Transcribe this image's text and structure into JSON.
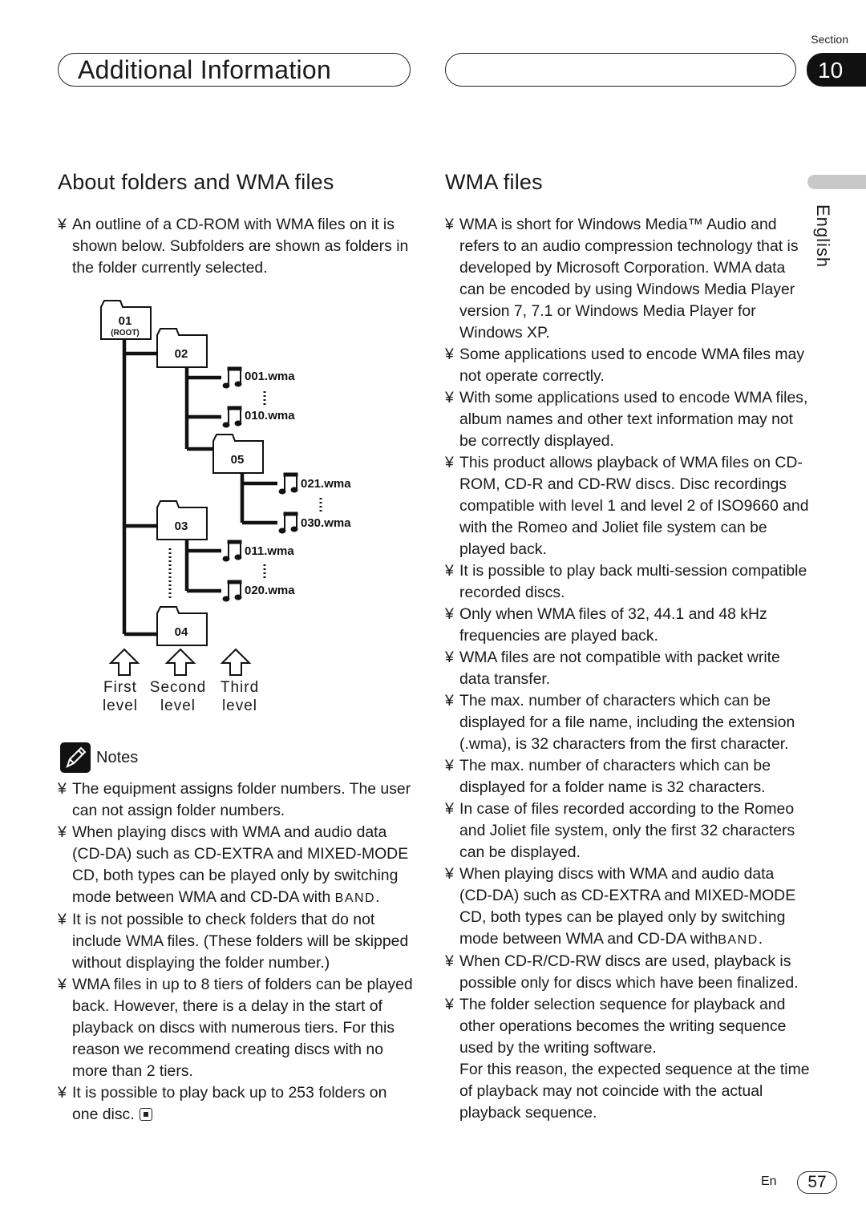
{
  "header": {
    "title": "Additional Information",
    "section_label": "Section",
    "section_number": "10"
  },
  "language_tab": "English",
  "left": {
    "heading": "About folders and WMA files",
    "intro": [
      "An outline of a CD-ROM with WMA files on it is shown below. Subfolders are shown as folders in the folder currently selected."
    ],
    "diagram": {
      "folders": [
        {
          "id": "01",
          "sub": "(ROOT)"
        },
        {
          "id": "02"
        },
        {
          "id": "05"
        },
        {
          "id": "03"
        },
        {
          "id": "04"
        }
      ],
      "files": [
        "001.wma",
        "010.wma",
        "021.wma",
        "030.wma",
        "011.wma",
        "020.wma"
      ],
      "levels": [
        {
          "line1": "First",
          "line2": "level"
        },
        {
          "line1": "Second",
          "line2": "level"
        },
        {
          "line1": "Third",
          "line2": "level"
        }
      ]
    },
    "notes_label": "Notes",
    "notes": [
      "The equipment assigns folder numbers. The user can not assign folder numbers.",
      "When playing discs with WMA and audio data (CD-DA) such as CD-EXTRA and MIXED-MODE CD, both types can be played only by switching mode between WMA and CD-DA with",
      "It is not possible to check folders that do not include WMA files. (These folders will be skipped without displaying the folder number.)",
      "WMA files in up to 8 tiers of folders can be played back. However, there is a delay in the start of playback on discs with numerous tiers. For this reason we recommend creating discs with no more than 2 tiers.",
      "It is possible to play back up to 253 folders on one disc."
    ],
    "band_label": "BAND",
    "band_suffix": "."
  },
  "right": {
    "heading": "WMA files",
    "items": [
      "WMA is short for Windows Media™ Audio and refers to an audio compression technology that is developed by Microsoft Corporation. WMA data can be encoded by using Windows Media Player version 7, 7.1 or Windows Media Player for Windows XP.",
      "Some applications used to encode WMA files may not operate correctly.",
      "With some applications used to encode WMA files, album names and other text information may not be correctly displayed.",
      "This product allows playback of WMA files on CD-ROM, CD-R and CD-RW discs. Disc recordings compatible with level 1 and level 2 of ISO9660 and with the Romeo and Joliet file system can be played back.",
      "It is possible to play back multi-session compatible recorded discs.",
      "Only when WMA files of 32, 44.1 and 48 kHz frequencies are played back.",
      "WMA files are not compatible with packet write data transfer.",
      "The max. number of characters which can be displayed for a file name, including the extension (.wma), is 32 characters from the first character.",
      "The max. number of characters which can be displayed for a folder name is 32 characters.",
      "In case of files recorded according to the Romeo and Joliet file system, only the first 32 characters can be displayed.",
      "When playing discs with WMA and audio data (CD-DA) such as CD-EXTRA and MIXED-MODE CD, both types can be played only by switching mode between WMA and CD-DA with",
      "When CD-R/CD-RW discs are used, playback is possible only for discs which have been finalized.",
      "The folder selection sequence for playback and other operations becomes the writing sequence used by the writing software."
    ],
    "continuation": "For this reason, the expected sequence at the time of playback may not coincide with the actual playback sequence.",
    "band_label": "BAND",
    "band_suffix": "."
  },
  "footer": {
    "lang_code": "En",
    "page_number": "57"
  }
}
